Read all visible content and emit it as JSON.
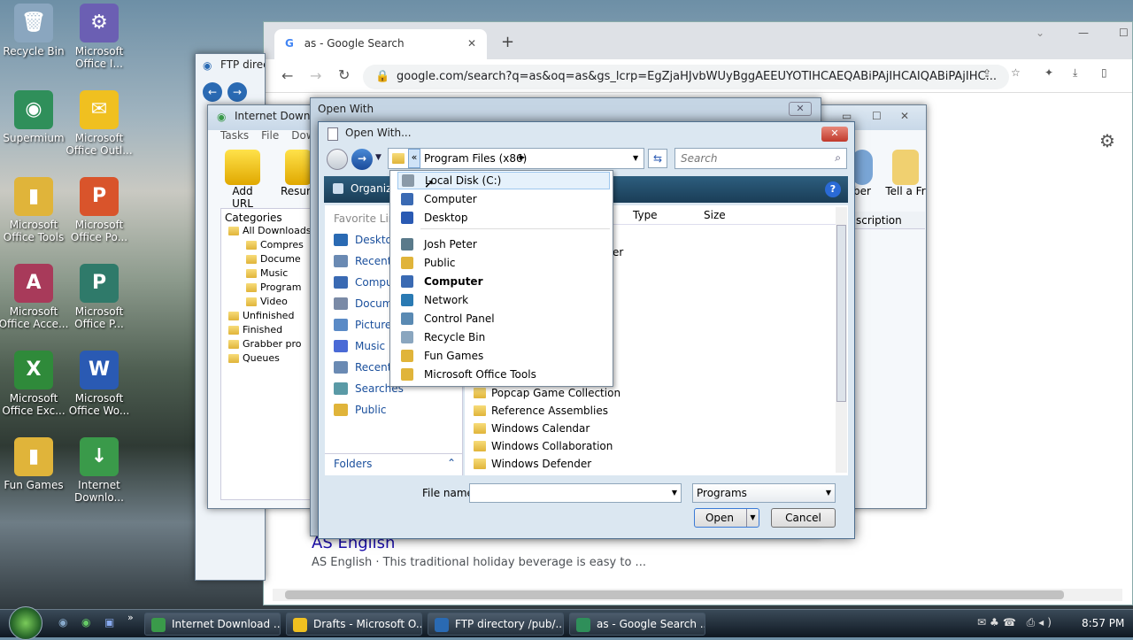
{
  "desktop": {
    "icons": [
      {
        "label": "Recycle Bin",
        "glyph": "🗑",
        "color": "#8aa6bf"
      },
      {
        "label": "Microsoft Office I...",
        "glyph": "⚙",
        "color": "#6b5fb3"
      },
      {
        "label": "Supermium",
        "glyph": "◉",
        "color": "#2f8f5a"
      },
      {
        "label": "Microsoft Office Outl...",
        "glyph": "✉",
        "color": "#f0c020"
      },
      {
        "label": "Microsoft Office Tools",
        "glyph": "▮",
        "color": "#e0b43a"
      },
      {
        "label": "Microsoft Office Po...",
        "glyph": "P",
        "color": "#d9542b"
      },
      {
        "label": "Microsoft Office Acce...",
        "glyph": "A",
        "color": "#a83a5a"
      },
      {
        "label": "Microsoft Office P...",
        "glyph": "P",
        "color": "#2f7a6a"
      },
      {
        "label": "Microsoft Office Exc...",
        "glyph": "X",
        "color": "#2f8a3a"
      },
      {
        "label": "Microsoft Office Wo...",
        "glyph": "W",
        "color": "#2a5ab3"
      },
      {
        "label": "Fun Games",
        "glyph": "▮",
        "color": "#e0b43a"
      },
      {
        "label": "Internet Downlo...",
        "glyph": "↓",
        "color": "#3a9a4a"
      }
    ]
  },
  "chrome": {
    "tab_title": "as - Google Search",
    "url": "google.com/search?q=as&oq=as&gs_lcrp=EgZjaHJvbWUyBggAEEUYOTIHCAEQABiPAjIHCAIQABiPAjIHC...",
    "result_title": "AS English",
    "result_snippet": "AS English · This traditional holiday beverage is easy to ..."
  },
  "ftp_window": {
    "title": "FTP directory /pub/..."
  },
  "idm_window": {
    "title": "Internet Download Manager",
    "menu": [
      "Tasks",
      "File",
      "Downl"
    ],
    "toolbar": [
      "Add URL",
      "Resum",
      "ber",
      "Tell a Fr"
    ],
    "categories_label": "Categories",
    "tree": [
      "All Downloads",
      "Compres",
      "Docume",
      "Music",
      "Program",
      "Video",
      "Unfinished",
      "Finished",
      "Grabber pro",
      "Queues"
    ],
    "column_partial": "scription"
  },
  "open_with_outer": {
    "title": "Open With"
  },
  "dialog": {
    "title": "Open With...",
    "breadcrumb": "Program Files (x86)",
    "search_placeholder": "Search",
    "organize": "Organiz",
    "nav_header": "Favorite Lin",
    "nav_items": [
      "Desktop",
      "Recent",
      "Compu",
      "Docum",
      "Pictures",
      "Music",
      "Recent",
      "Searches",
      "Public"
    ],
    "folders_label": "Folders",
    "columns": [
      "Type",
      "Size"
    ],
    "files": [
      "Popcap Game Collection",
      "Reference Assemblies",
      "Windows Calendar",
      "Windows Collaboration",
      "Windows Defender"
    ],
    "partial_file": "er",
    "filename_label": "File name:",
    "filename_value": "",
    "filetype": "Programs",
    "open_btn": "Open",
    "cancel_btn": "Cancel"
  },
  "dropdown": {
    "items": [
      {
        "label": "Local Disk (C:)",
        "bold": false,
        "color": "#8a9aa8"
      },
      {
        "label": "Computer",
        "bold": false,
        "color": "#3a6ab3"
      },
      {
        "label": "Desktop",
        "bold": false,
        "color": "#2a5ab3"
      },
      {
        "label": "Josh Peter",
        "bold": false,
        "color": "#5a7a8a"
      },
      {
        "label": "Public",
        "bold": false,
        "color": "#e0b43a"
      },
      {
        "label": "Computer",
        "bold": true,
        "color": "#3a6ab3"
      },
      {
        "label": "Network",
        "bold": false,
        "color": "#2a7ab3"
      },
      {
        "label": "Control Panel",
        "bold": false,
        "color": "#5a8ab3"
      },
      {
        "label": "Recycle Bin",
        "bold": false,
        "color": "#8aa6bf"
      },
      {
        "label": "Fun Games",
        "bold": false,
        "color": "#e0b43a"
      },
      {
        "label": "Microsoft Office Tools",
        "bold": false,
        "color": "#e0b43a"
      }
    ]
  },
  "taskbar": {
    "items": [
      {
        "label": "Internet Download ...",
        "color": "#3a9a4a"
      },
      {
        "label": "Drafts - Microsoft O...",
        "color": "#f0c020"
      },
      {
        "label": "FTP directory /pub/...",
        "color": "#2a6ab3"
      },
      {
        "label": "as - Google Search ...",
        "color": "#2f8f5a"
      }
    ],
    "clock": "8:57 PM"
  }
}
